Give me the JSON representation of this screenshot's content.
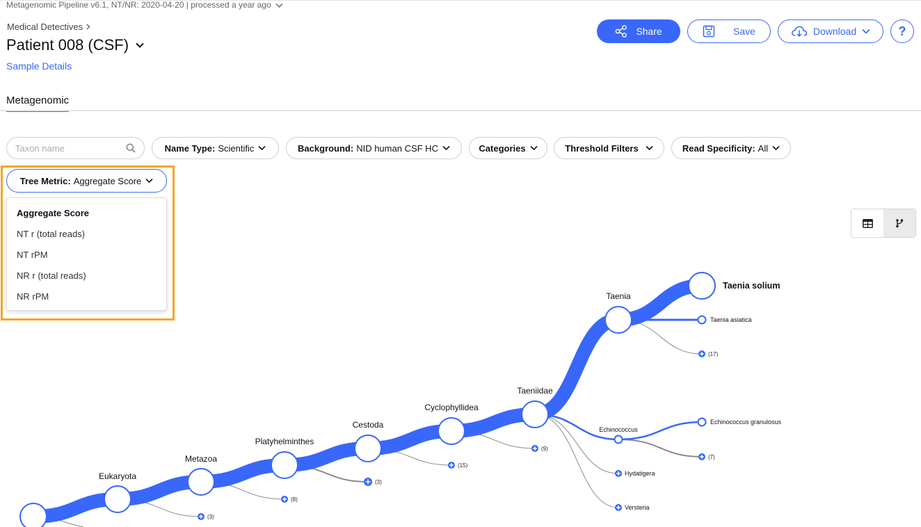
{
  "header": {
    "pipeline_info": "Metagenomic Pipeline v6.1, NT/NR: 2020-04-20 | processed a year ago",
    "breadcrumb": "Medical Detectives",
    "title": "Patient 008 (CSF)",
    "sample_details_link": "Sample Details",
    "share_label": "Share",
    "save_label": "Save",
    "download_label": "Download",
    "help_label": "?",
    "accent_color": "#3867fa"
  },
  "tabs": [
    {
      "label": "Metagenomic",
      "active": true
    }
  ],
  "filters": {
    "search_placeholder": "Taxon name",
    "name_type": {
      "label": "Name Type:",
      "value": "Scientific"
    },
    "background": {
      "label": "Background:",
      "value": "NID human CSF HC"
    },
    "categories": {
      "label": "Categories"
    },
    "threshold": {
      "label": "Threshold Filters"
    },
    "read_specificity": {
      "label": "Read Specificity:",
      "value": "All"
    },
    "tree_metric": {
      "label": "Tree Metric:",
      "value": "Aggregate Score"
    }
  },
  "tree_metric_menu": {
    "options": [
      "Aggregate Score",
      "NT r (total reads)",
      "NT rPM",
      "NR r (total reads)",
      "NR rPM"
    ],
    "selected": "Aggregate Score",
    "highlight_color": "#f5a623"
  },
  "view_toggle": {
    "icons": [
      "table-icon",
      "tree-icon"
    ],
    "active": "tree-icon"
  },
  "tree": {
    "nodes": {
      "eukaryota": "Eukaryota",
      "metazoa": "Metazoa",
      "platyhelminthes": "Platyhelminthes",
      "cestoda": "Cestoda",
      "cyclophyllidea": "Cyclophyllidea",
      "taeniidae": "Taeniidae",
      "taenia": "Taenia",
      "taenia_solium": "Taenia solium",
      "taenia_asiatica": "Taenia asiatica",
      "echinococcus": "Echinococcus",
      "echinococcus_granulosus": "Echinococcus granulosus",
      "hydatigera": "Hydatigera",
      "versteria": "Versteria"
    },
    "collapsed_counts": {
      "eukaryota": "(3)",
      "metazoa": "(8)",
      "platyhelminthes": "(3)",
      "cestoda": "(15)",
      "cyclophyllidea": "(9)",
      "taenia": "(17)",
      "echinococcus": "(7)"
    }
  }
}
